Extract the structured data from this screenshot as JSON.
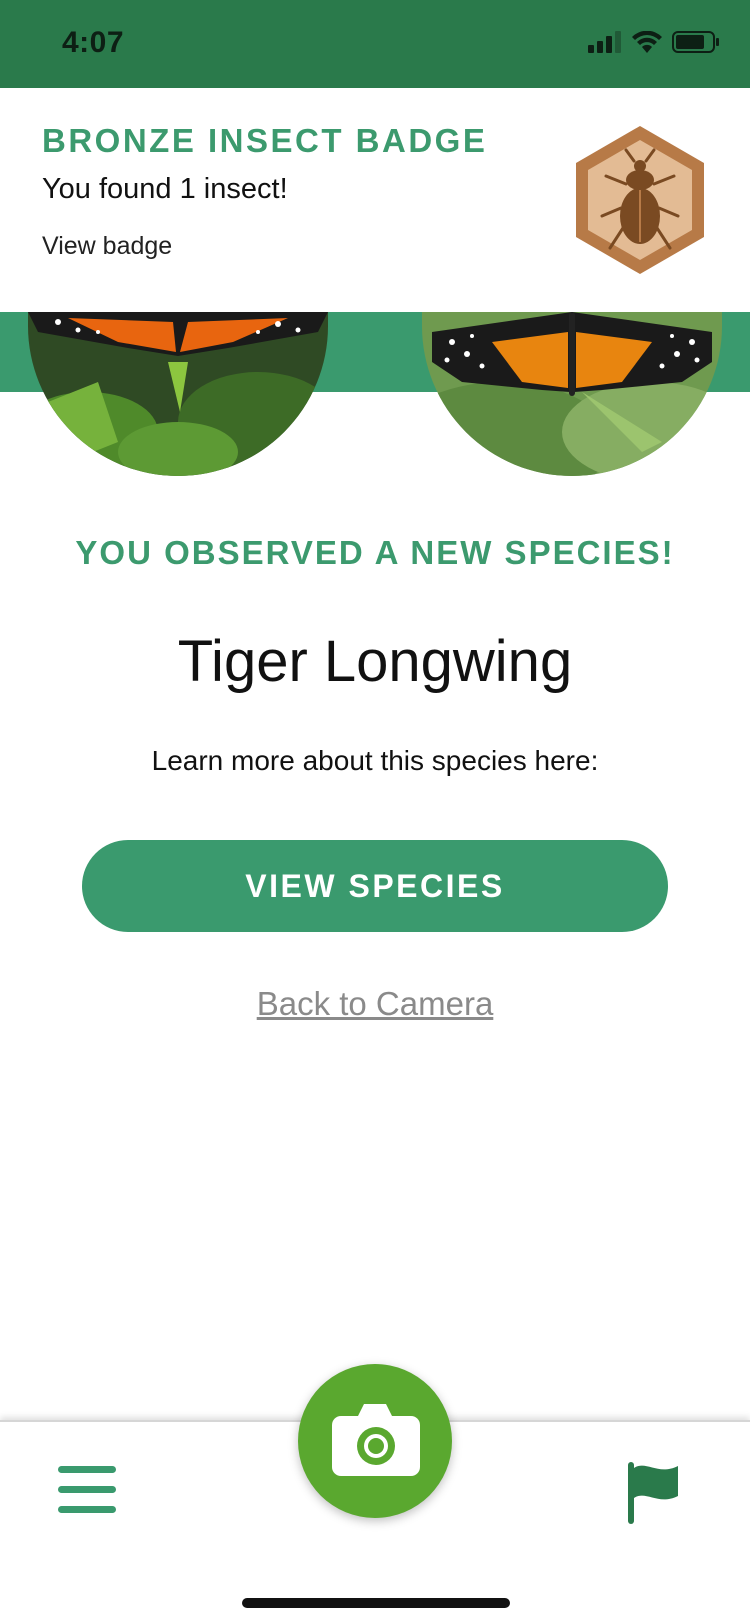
{
  "status": {
    "time": "4:07"
  },
  "badge": {
    "title": "BRONZE INSECT BADGE",
    "subtitle": "You found 1 insect!",
    "link": "View badge"
  },
  "observation": {
    "headline": "YOU OBSERVED A NEW SPECIES!",
    "species": "Tiger Longwing",
    "learn_more": "Learn more about this species here:",
    "view_button": "VIEW SPECIES",
    "back_link": "Back to Camera"
  },
  "nav": {
    "menu_icon": "hamburger-icon",
    "camera_icon": "camera-icon",
    "flag_icon": "flag-icon"
  },
  "colors": {
    "primary_green": "#3a9a6e",
    "status_green": "#2a7a4b",
    "camera_green": "#5aa82f",
    "badge_bronze": "#b77a47"
  }
}
